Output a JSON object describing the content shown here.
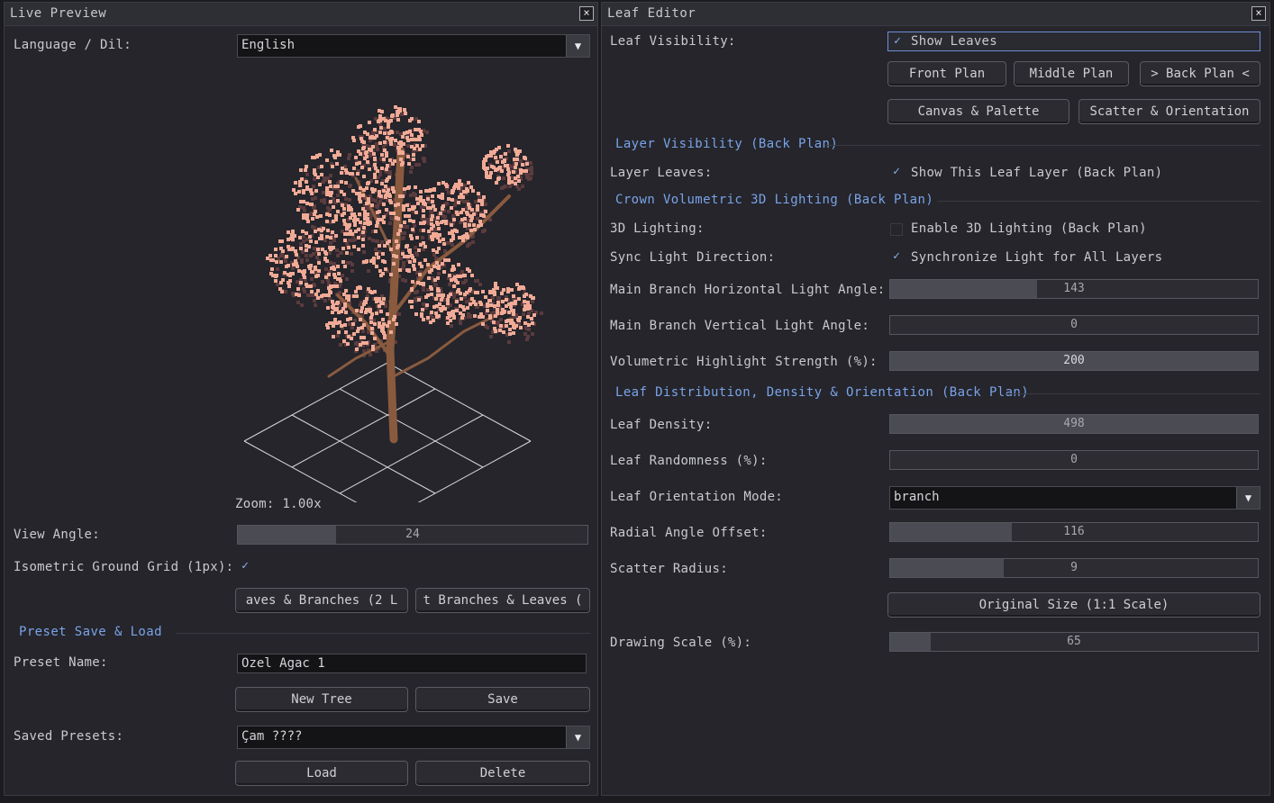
{
  "left": {
    "title": "Live Preview",
    "close_icon": "×",
    "language_label": "Language / Dil:",
    "language_value": "English",
    "zoom_text": "Zoom: 1.00x",
    "view_angle_label": "View Angle:",
    "view_angle_value": "24",
    "view_angle_fraction": 0.28,
    "grid_label": "Isometric Ground Grid (1px):",
    "grid_checked": true,
    "order_btn_1": "aves & Branches (2 L",
    "order_btn_2": "t Branches & Leaves (",
    "preset_section": "Preset Save & Load",
    "preset_name_label": "Preset Name:",
    "preset_name_value": "Ozel Agac 1",
    "new_tree": "New Tree",
    "save": "Save",
    "saved_presets_label": "Saved Presets:",
    "saved_presets_value": "Çam ????",
    "load": "Load",
    "delete": "Delete"
  },
  "right": {
    "title": "Leaf Editor",
    "close_icon": "×",
    "leaf_visibility_label": "Leaf Visibility:",
    "show_leaves": "Show Leaves",
    "front_plan": "Front Plan",
    "middle_plan": "Middle Plan",
    "back_plan": "> Back Plan <",
    "canvas_palette": "Canvas & Palette",
    "scatter_orientation": "Scatter & Orientation",
    "layer_section": "Layer Visibility (Back Plan)",
    "layer_leaves_label": "Layer Leaves:",
    "layer_leaves_text": "Show This Leaf Layer (Back Plan)",
    "crown_section": "Crown Volumetric 3D Lighting (Back Plan)",
    "lighting_label": "3D Lighting:",
    "lighting_text": "Enable 3D Lighting (Back Plan)",
    "sync_label": "Sync Light Direction:",
    "sync_text": "Synchronize Light for All Layers",
    "h_angle_label": "Main Branch Horizontal Light Angle:",
    "h_angle_value": "143",
    "h_angle_fraction": 0.4,
    "v_angle_label": "Main Branch Vertical Light Angle:",
    "v_angle_value": "0",
    "v_angle_fraction": 0,
    "highlight_label": "Volumetric Highlight Strength (%):",
    "highlight_value": "200",
    "highlight_fraction": 1.0,
    "dist_section": "Leaf Distribution, Density & Orientation (Back Plan)",
    "density_label": "Leaf Density:",
    "density_value": "498",
    "density_fraction": 1.0,
    "randomness_label": "Leaf Randomness (%):",
    "randomness_value": "0",
    "randomness_fraction": 0,
    "orientation_label": "Leaf Orientation Mode:",
    "orientation_value": "branch",
    "radial_label": "Radial Angle Offset:",
    "radial_value": "116",
    "radial_fraction": 0.33,
    "scatter_label": "Scatter Radius:",
    "scatter_value": "9",
    "scatter_fraction": 0.31,
    "original_size": "Original Size (1:1 Scale)",
    "drawing_scale_label": "Drawing Scale (%):",
    "drawing_scale_value": "65",
    "drawing_scale_fraction": 0.11
  },
  "colors": {
    "section": "#7aa3e8",
    "leaf": "#f0aa96",
    "leaf_shadow": "#5a3b3e",
    "trunk": "#8a5a3e"
  }
}
